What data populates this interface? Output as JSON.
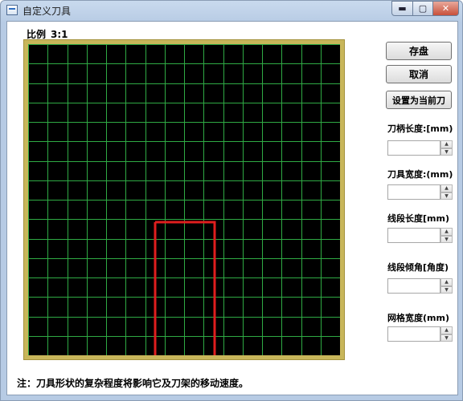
{
  "window": {
    "title": "自定义刀具"
  },
  "canvas": {
    "scale_label": "比例",
    "scale_value": "3:1",
    "grid_cells": 16,
    "grid_color": "#2faa44",
    "tool_color": "#e01e1e",
    "background": "#000000"
  },
  "buttons": {
    "save": "存盘",
    "cancel": "取消",
    "set_current": "设置为当前刀"
  },
  "fields": [
    {
      "label": "刀柄长度:[mm)",
      "value": ""
    },
    {
      "label": "刀具宽度:(mm)",
      "value": ""
    },
    {
      "label": "线段长度[mm)",
      "value": ""
    },
    {
      "label": "线段倾角[角度)",
      "value": ""
    },
    {
      "label": "网格宽度(mm)",
      "value": ""
    }
  ],
  "note": "注：刀具形状的复杂程度将影响它及刀架的移动速度。"
}
